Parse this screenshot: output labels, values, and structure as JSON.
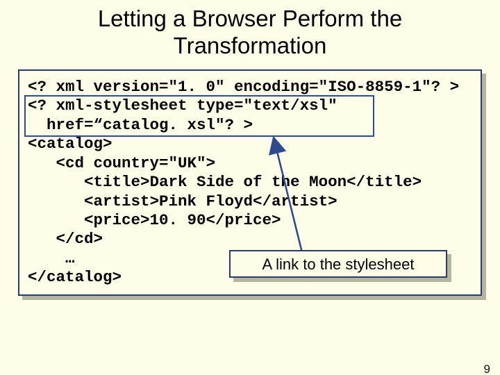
{
  "title": "Letting a Browser Perform the Transformation",
  "code": {
    "l1": "<? xml version=\"1. 0\" encoding=\"ISO-8859-1\"? >",
    "l2": "<? xml-stylesheet type=\"text/xsl\"",
    "l3": "  href=“catalog. xsl\"? >",
    "l4": "<catalog>",
    "l5": "   <cd country=\"UK\">",
    "l6": "      <title>Dark Side of the Moon</title>",
    "l7": "      <artist>Pink Floyd</artist>",
    "l8": "      <price>10. 90</price>",
    "l9": "   </cd>",
    "l10": "    …",
    "l11": "</catalog>"
  },
  "callout": "A link to the stylesheet",
  "page_number": "9"
}
